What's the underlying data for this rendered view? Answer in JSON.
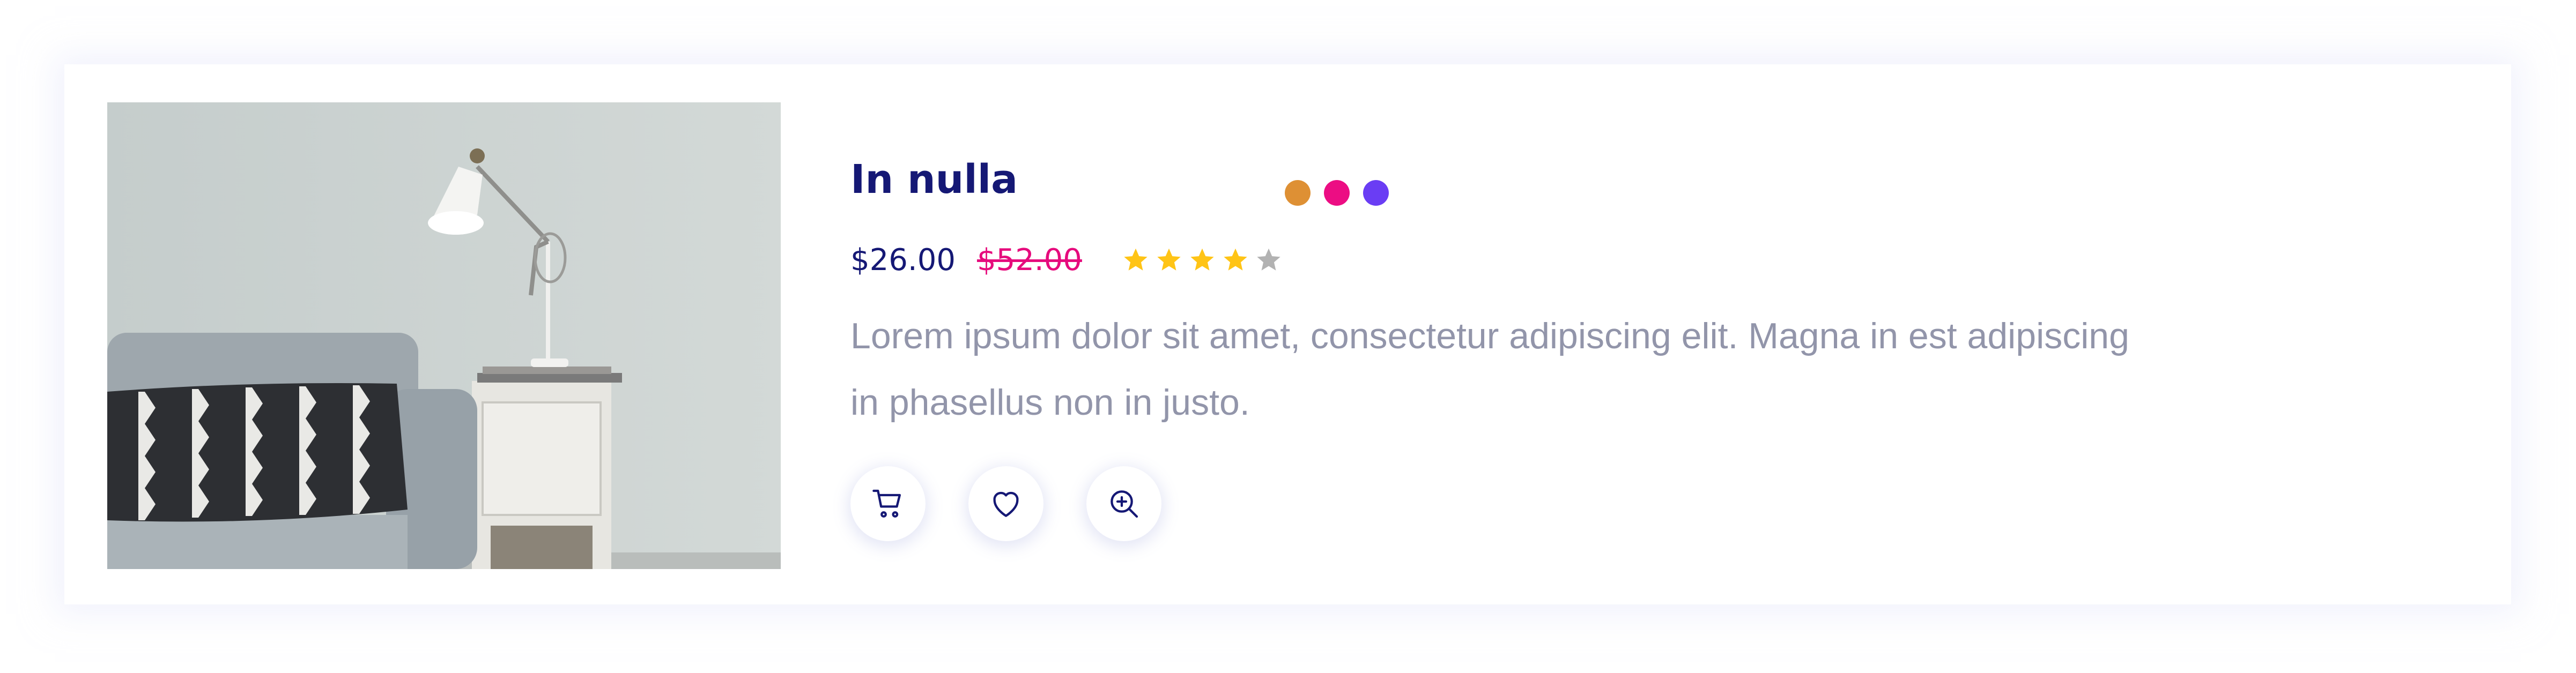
{
  "product": {
    "title": "In nulla",
    "price": "$26.00",
    "old_price": "$52.00",
    "rating": 4,
    "rating_max": 5,
    "description": "Lorem ipsum dolor sit amet, consectetur adipiscing elit. Magna in est adipiscing in phasellus non in justo.",
    "color_options": [
      {
        "name": "orange",
        "hex": "#DE9034"
      },
      {
        "name": "pink",
        "hex": "#EC0D83"
      },
      {
        "name": "purple",
        "hex": "#6A3DF4"
      }
    ],
    "image_icon": "sofa-with-lamp-photo"
  },
  "actions": [
    {
      "icon": "cart-icon"
    },
    {
      "icon": "heart-icon"
    },
    {
      "icon": "zoom-in-icon"
    }
  ],
  "colors": {
    "title": "#151875",
    "old_price": "#E60B7D",
    "description": "#9295AA",
    "star_filled": "#FFC416",
    "star_empty": "#B2B2B2",
    "icon": "#151875"
  }
}
